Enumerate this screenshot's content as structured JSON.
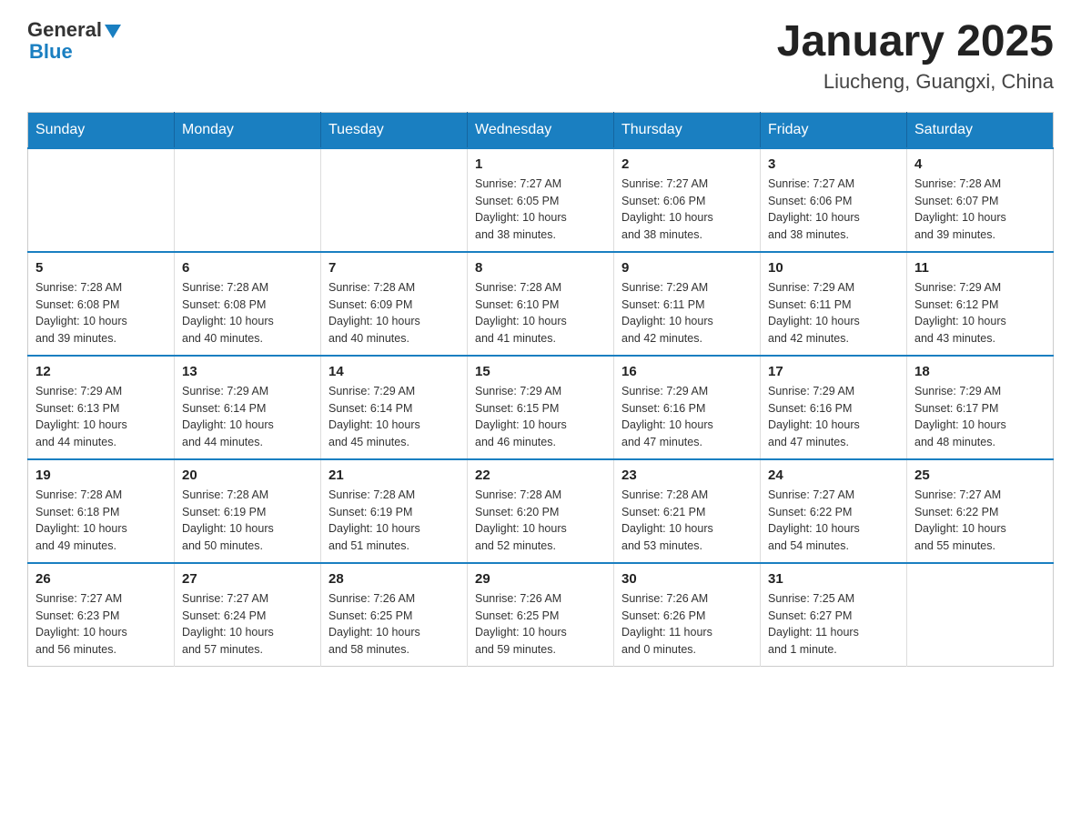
{
  "header": {
    "logo_general": "General",
    "logo_blue": "Blue",
    "title": "January 2025",
    "subtitle": "Liucheng, Guangxi, China"
  },
  "calendar": {
    "days_of_week": [
      "Sunday",
      "Monday",
      "Tuesday",
      "Wednesday",
      "Thursday",
      "Friday",
      "Saturday"
    ],
    "weeks": [
      [
        {
          "day": "",
          "info": ""
        },
        {
          "day": "",
          "info": ""
        },
        {
          "day": "",
          "info": ""
        },
        {
          "day": "1",
          "info": "Sunrise: 7:27 AM\nSunset: 6:05 PM\nDaylight: 10 hours\nand 38 minutes."
        },
        {
          "day": "2",
          "info": "Sunrise: 7:27 AM\nSunset: 6:06 PM\nDaylight: 10 hours\nand 38 minutes."
        },
        {
          "day": "3",
          "info": "Sunrise: 7:27 AM\nSunset: 6:06 PM\nDaylight: 10 hours\nand 38 minutes."
        },
        {
          "day": "4",
          "info": "Sunrise: 7:28 AM\nSunset: 6:07 PM\nDaylight: 10 hours\nand 39 minutes."
        }
      ],
      [
        {
          "day": "5",
          "info": "Sunrise: 7:28 AM\nSunset: 6:08 PM\nDaylight: 10 hours\nand 39 minutes."
        },
        {
          "day": "6",
          "info": "Sunrise: 7:28 AM\nSunset: 6:08 PM\nDaylight: 10 hours\nand 40 minutes."
        },
        {
          "day": "7",
          "info": "Sunrise: 7:28 AM\nSunset: 6:09 PM\nDaylight: 10 hours\nand 40 minutes."
        },
        {
          "day": "8",
          "info": "Sunrise: 7:28 AM\nSunset: 6:10 PM\nDaylight: 10 hours\nand 41 minutes."
        },
        {
          "day": "9",
          "info": "Sunrise: 7:29 AM\nSunset: 6:11 PM\nDaylight: 10 hours\nand 42 minutes."
        },
        {
          "day": "10",
          "info": "Sunrise: 7:29 AM\nSunset: 6:11 PM\nDaylight: 10 hours\nand 42 minutes."
        },
        {
          "day": "11",
          "info": "Sunrise: 7:29 AM\nSunset: 6:12 PM\nDaylight: 10 hours\nand 43 minutes."
        }
      ],
      [
        {
          "day": "12",
          "info": "Sunrise: 7:29 AM\nSunset: 6:13 PM\nDaylight: 10 hours\nand 44 minutes."
        },
        {
          "day": "13",
          "info": "Sunrise: 7:29 AM\nSunset: 6:14 PM\nDaylight: 10 hours\nand 44 minutes."
        },
        {
          "day": "14",
          "info": "Sunrise: 7:29 AM\nSunset: 6:14 PM\nDaylight: 10 hours\nand 45 minutes."
        },
        {
          "day": "15",
          "info": "Sunrise: 7:29 AM\nSunset: 6:15 PM\nDaylight: 10 hours\nand 46 minutes."
        },
        {
          "day": "16",
          "info": "Sunrise: 7:29 AM\nSunset: 6:16 PM\nDaylight: 10 hours\nand 47 minutes."
        },
        {
          "day": "17",
          "info": "Sunrise: 7:29 AM\nSunset: 6:16 PM\nDaylight: 10 hours\nand 47 minutes."
        },
        {
          "day": "18",
          "info": "Sunrise: 7:29 AM\nSunset: 6:17 PM\nDaylight: 10 hours\nand 48 minutes."
        }
      ],
      [
        {
          "day": "19",
          "info": "Sunrise: 7:28 AM\nSunset: 6:18 PM\nDaylight: 10 hours\nand 49 minutes."
        },
        {
          "day": "20",
          "info": "Sunrise: 7:28 AM\nSunset: 6:19 PM\nDaylight: 10 hours\nand 50 minutes."
        },
        {
          "day": "21",
          "info": "Sunrise: 7:28 AM\nSunset: 6:19 PM\nDaylight: 10 hours\nand 51 minutes."
        },
        {
          "day": "22",
          "info": "Sunrise: 7:28 AM\nSunset: 6:20 PM\nDaylight: 10 hours\nand 52 minutes."
        },
        {
          "day": "23",
          "info": "Sunrise: 7:28 AM\nSunset: 6:21 PM\nDaylight: 10 hours\nand 53 minutes."
        },
        {
          "day": "24",
          "info": "Sunrise: 7:27 AM\nSunset: 6:22 PM\nDaylight: 10 hours\nand 54 minutes."
        },
        {
          "day": "25",
          "info": "Sunrise: 7:27 AM\nSunset: 6:22 PM\nDaylight: 10 hours\nand 55 minutes."
        }
      ],
      [
        {
          "day": "26",
          "info": "Sunrise: 7:27 AM\nSunset: 6:23 PM\nDaylight: 10 hours\nand 56 minutes."
        },
        {
          "day": "27",
          "info": "Sunrise: 7:27 AM\nSunset: 6:24 PM\nDaylight: 10 hours\nand 57 minutes."
        },
        {
          "day": "28",
          "info": "Sunrise: 7:26 AM\nSunset: 6:25 PM\nDaylight: 10 hours\nand 58 minutes."
        },
        {
          "day": "29",
          "info": "Sunrise: 7:26 AM\nSunset: 6:25 PM\nDaylight: 10 hours\nand 59 minutes."
        },
        {
          "day": "30",
          "info": "Sunrise: 7:26 AM\nSunset: 6:26 PM\nDaylight: 11 hours\nand 0 minutes."
        },
        {
          "day": "31",
          "info": "Sunrise: 7:25 AM\nSunset: 6:27 PM\nDaylight: 11 hours\nand 1 minute."
        },
        {
          "day": "",
          "info": ""
        }
      ]
    ]
  }
}
